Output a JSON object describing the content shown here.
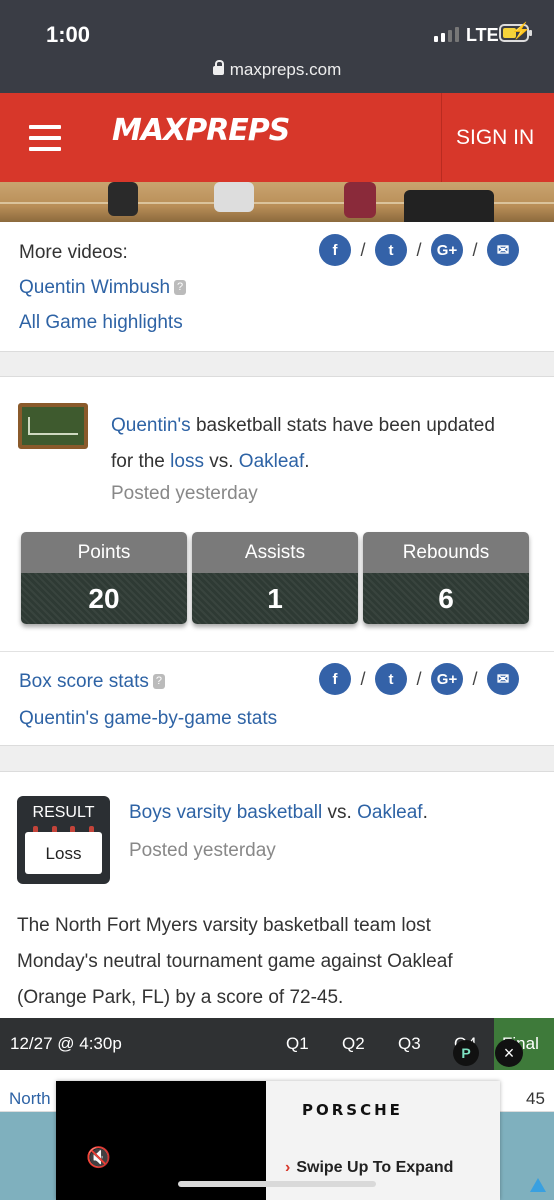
{
  "status_bar": {
    "time": "1:00",
    "network": "LTE",
    "url": "maxpreps.com"
  },
  "header": {
    "logo": "MAXPREPS",
    "sign_in": "SIGN IN"
  },
  "videos_card": {
    "more_videos_label": "More videos:",
    "player_link": "Quentin Wimbush",
    "highlights_link": "All Game highlights",
    "separator": "/"
  },
  "stats_card": {
    "player_link": "Quentin's",
    "text_1": "basketball stats have been updated",
    "text_2": "for the",
    "result_link": "loss",
    "text_3": "vs.",
    "opponent_link": "Oakleaf",
    "period": ".",
    "posted": "Posted yesterday",
    "stats": [
      {
        "label": "Points",
        "value": "20"
      },
      {
        "label": "Assists",
        "value": "1"
      },
      {
        "label": "Rebounds",
        "value": "6"
      }
    ],
    "box_score_link": "Box score stats",
    "game_by_game_link": "Quentin's game-by-game stats"
  },
  "result_card": {
    "badge_label": "RESULT",
    "badge_value": "Loss",
    "team_link": "Boys varsity basketball",
    "vs": "vs.",
    "opponent_link": "Oakleaf",
    "period": ".",
    "posted": "Posted yesterday",
    "summary_1": "The North Fort Myers varsity basketball team lost",
    "summary_2": "Monday's neutral tournament game against Oakleaf",
    "summary_3": "(Orange Park, FL) by a score of 72-45."
  },
  "scoreboard": {
    "date": "12/27 @ 4:30p",
    "q1": "Q1",
    "q2": "Q2",
    "q3": "Q3",
    "q4": "Q4",
    "final": "Final",
    "team": "North",
    "team_total": "45"
  },
  "ad": {
    "brand": "PORSCHE",
    "cta": "Swipe Up To Expand",
    "close": "×"
  },
  "colors": {
    "brand_red": "#d7372a",
    "link_blue": "#2e63a5",
    "social_blue": "#3462a8"
  }
}
